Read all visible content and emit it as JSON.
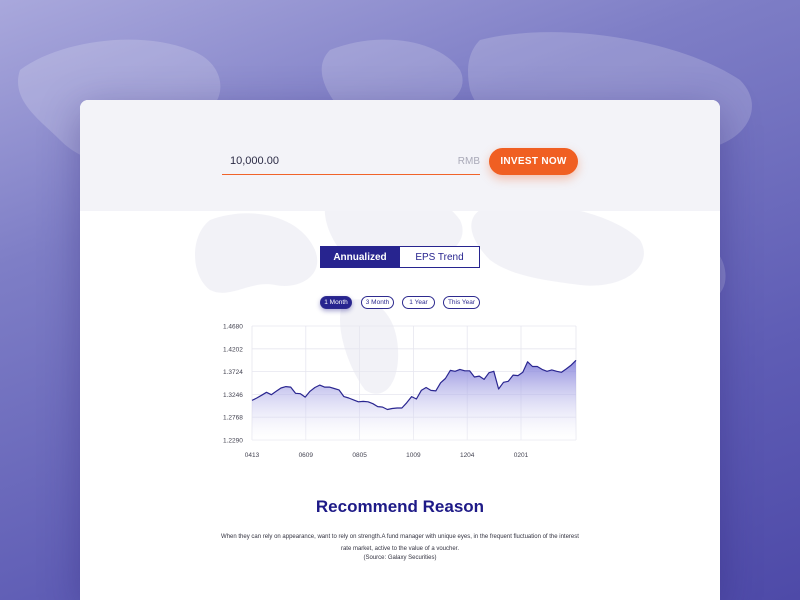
{
  "invest": {
    "amount_value": "10,000.00",
    "currency_unit": "RMB",
    "invest_button_label": "INVEST NOW"
  },
  "tabs": [
    {
      "label": "Annualized",
      "active": true
    },
    {
      "label": "EPS Trend",
      "active": false
    }
  ],
  "ranges": [
    {
      "label": "1 Month",
      "active": true
    },
    {
      "label": "3 Month",
      "active": false
    },
    {
      "label": "1 Year",
      "active": false
    },
    {
      "label": "This Year",
      "active": false
    }
  ],
  "chart_data": {
    "type": "area",
    "title": "",
    "xlabel": "",
    "ylabel": "",
    "x_ticks": [
      "0413",
      "0609",
      "0805",
      "1009",
      "1204",
      "0201"
    ],
    "y_ticks": [
      "1.4680",
      "1.4202",
      "1.3724",
      "1.3246",
      "1.2768",
      "1.2290"
    ],
    "ylim": [
      1.229,
      1.468
    ],
    "grid": true,
    "series": [
      {
        "values": [
          1.312,
          1.317,
          1.323,
          1.329,
          1.324,
          1.331,
          1.338,
          1.341,
          1.34,
          1.327,
          1.326,
          1.319,
          1.331,
          1.339,
          1.344,
          1.34,
          1.34,
          1.337,
          1.334,
          1.32,
          1.317,
          1.313,
          1.309,
          1.31,
          1.309,
          1.305,
          1.299,
          1.298,
          1.293,
          1.295,
          1.296,
          1.296,
          1.307,
          1.32,
          1.315,
          1.333,
          1.339,
          1.333,
          1.332,
          1.349,
          1.358,
          1.375,
          1.373,
          1.377,
          1.374,
          1.374,
          1.361,
          1.363,
          1.356,
          1.37,
          1.373,
          1.336,
          1.35,
          1.352,
          1.365,
          1.364,
          1.371,
          1.393,
          1.383,
          1.383,
          1.377,
          1.373,
          1.376,
          1.373,
          1.371,
          1.378,
          1.386,
          1.396
        ]
      }
    ],
    "colors": {
      "line": "#2a2690",
      "fill_top": "#7c79d8",
      "fill_bottom": "#ffffff"
    }
  },
  "recommend": {
    "title": "Recommend Reason",
    "text": "When they can rely on appearance, want to rely on strength.A fund manager with unique eyes, in the frequent fluctuation of the interest rate market, active to the value of a voucher.",
    "source": "(Source: Galaxy Securities)"
  },
  "colors": {
    "accent": "#f05f22",
    "primary": "#27248f",
    "background": "#5f5db5"
  }
}
